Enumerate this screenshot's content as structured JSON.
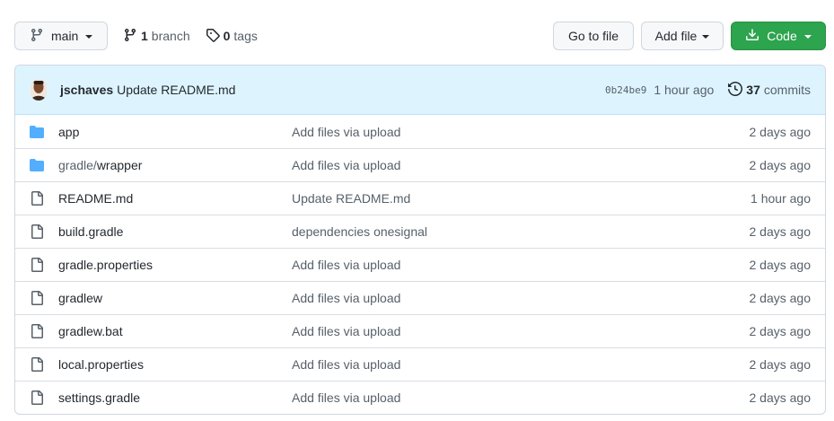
{
  "toolbar": {
    "branch_name": "main",
    "branch_count": "1",
    "branch_label": "branch",
    "tag_count": "0",
    "tag_label": "tags",
    "goto_file": "Go to file",
    "add_file": "Add file",
    "code": "Code"
  },
  "commit": {
    "author": "jschaves",
    "message": "Update README.md",
    "sha": "0b24be9",
    "time": "1 hour ago",
    "commit_count": "37",
    "commits_label": "commits"
  },
  "files": [
    {
      "type": "dir",
      "name": "app",
      "name_suffix": "",
      "commit": "Add files via upload",
      "time": "2 days ago"
    },
    {
      "type": "dir",
      "name": "gradle/",
      "name_suffix": "wrapper",
      "commit": "Add files via upload",
      "time": "2 days ago"
    },
    {
      "type": "file",
      "name": "README.md",
      "name_suffix": "",
      "commit": "Update README.md",
      "time": "1 hour ago"
    },
    {
      "type": "file",
      "name": "build.gradle",
      "name_suffix": "",
      "commit": "dependencies onesignal",
      "time": "2 days ago"
    },
    {
      "type": "file",
      "name": "gradle.properties",
      "name_suffix": "",
      "commit": "Add files via upload",
      "time": "2 days ago"
    },
    {
      "type": "file",
      "name": "gradlew",
      "name_suffix": "",
      "commit": "Add files via upload",
      "time": "2 days ago"
    },
    {
      "type": "file",
      "name": "gradlew.bat",
      "name_suffix": "",
      "commit": "Add files via upload",
      "time": "2 days ago"
    },
    {
      "type": "file",
      "name": "local.properties",
      "name_suffix": "",
      "commit": "Add files via upload",
      "time": "2 days ago"
    },
    {
      "type": "file",
      "name": "settings.gradle",
      "name_suffix": "",
      "commit": "Add files via upload",
      "time": "2 days ago"
    }
  ],
  "colors": {
    "accent_green": "#2da44e",
    "folder_blue": "#54aeff",
    "commit_bar_bg": "#ddf4ff"
  },
  "icons": {
    "branch": "git-branch-icon",
    "tag": "tag-icon",
    "download": "download-icon",
    "history": "history-icon",
    "folder": "folder-icon",
    "file": "file-icon"
  }
}
